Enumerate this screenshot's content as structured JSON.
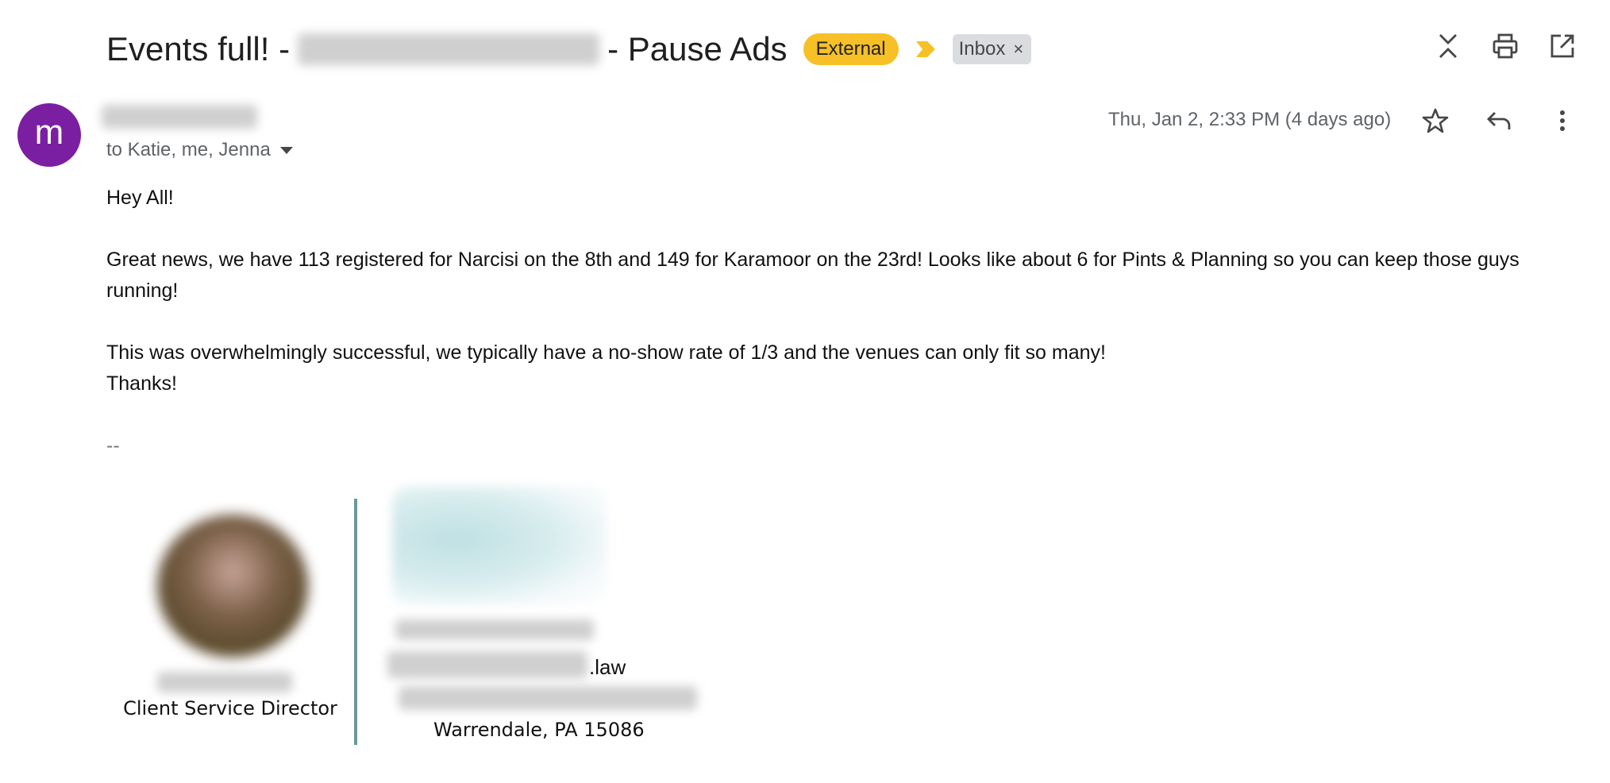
{
  "subject": {
    "prefix": "Events full! -",
    "suffix": "- Pause Ads",
    "external_label": "External",
    "label_chip": "Inbox",
    "label_remove": "×"
  },
  "colors": {
    "external": "#f6c026",
    "avatar": "#7b1fa2",
    "importance": "#f6c026",
    "divider": "#6b9898"
  },
  "header_icons": [
    "collapse-all-icon",
    "print-icon",
    "open-in-new-window-icon"
  ],
  "message": {
    "avatar_letter": "m",
    "recipients": "to Katie, me, Jenna",
    "date": "Thu, Jan 2, 2:33 PM (4 days ago)",
    "actions": [
      "star-icon",
      "reply-icon",
      "more-options-icon"
    ]
  },
  "body": {
    "greeting": "Hey All!",
    "para1": "Great news, we have 113 registered for Narcisi on the 8th and 149 for Karamoor on the 23rd! Looks like about 6 for Pints & Planning so you can keep those guys running!",
    "para2": "This was overwhelmingly successful, we typically have a no-show rate of 1/3 and the venues can only fit so many!",
    "thanks": "Thanks!",
    "sig_separator": "--"
  },
  "signature": {
    "title": "Client Service Director",
    "email_suffix": ".law",
    "address": "Warrendale, PA 15086"
  }
}
